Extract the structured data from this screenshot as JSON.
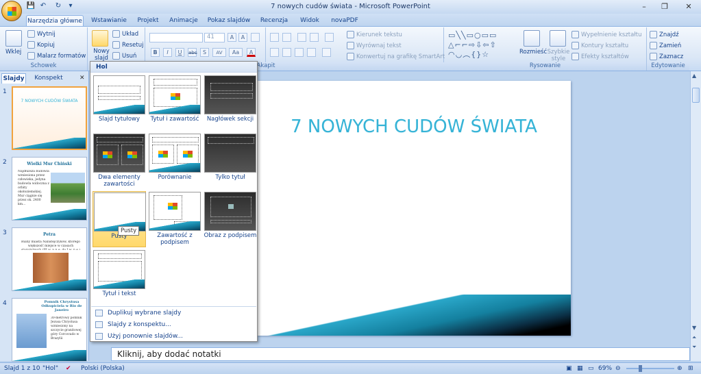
{
  "window": {
    "title": "7 nowych cudów świata - Microsoft PowerPoint",
    "minimize": "–",
    "restore": "❐",
    "close": "✕"
  },
  "qat": {
    "save": "💾",
    "undo": "↶",
    "redo": "↻",
    "more": "▾"
  },
  "tabs": [
    "Narzędzia główne",
    "Wstawianie",
    "Projekt",
    "Animacje",
    "Pokaz slajdów",
    "Recenzja",
    "Widok",
    "novaPDF"
  ],
  "ribbon": {
    "clipboard": {
      "label": "Schowek",
      "paste": "Wklej",
      "cut": "Wytnij",
      "copy": "Kopiuj",
      "format_painter": "Malarz formatów"
    },
    "slides": {
      "new_slide": "Nowy slajd",
      "layout": "Układ",
      "reset": "Resetuj",
      "delete": "Usuń"
    },
    "font": {
      "size": "41",
      "bold": "B",
      "italic": "I",
      "underline": "U",
      "strike": "abc",
      "shadow": "S",
      "spacing": "AV",
      "case": "Aa",
      "color": "A",
      "grow": "A",
      "shrink": "A"
    },
    "paragraph": {
      "label": "Akapit",
      "text_direction": "Kierunek tekstu",
      "align_text": "Wyrównaj tekst",
      "smartart": "Konwertuj na grafikę SmartArt"
    },
    "drawing": {
      "label": "Rysowanie",
      "arrange": "Rozmieść",
      "quick_styles": "Szybkie style",
      "fill": "Wypełnienie kształtu",
      "outline": "Kontury kształtu",
      "effects": "Efekty kształtów"
    },
    "editing": {
      "label": "Edytowanie",
      "find": "Znajdź",
      "replace": "Zamień",
      "select": "Zaznacz"
    }
  },
  "left_pane": {
    "tabs": [
      "Slajdy",
      "Konspekt"
    ],
    "slides": [
      {
        "num": "1",
        "title": "7 NOWYCH CUDÓW ŚWIATA"
      },
      {
        "num": "2",
        "title": "Wielki Mur Chiński",
        "text": "Najdłuższa budowla wzniesiona przez człowieka, jedyna budowla widoczna z orbity okołoziemskiej. Mur ciągnie się przez ok. 2400 km..."
      },
      {
        "num": "3",
        "title": "Petra",
        "text": "Ruiny miasta Nabatejczyków, którego większość miejsce w czasach starożytnych (III w. p.n.e. do I w. n.e.)"
      },
      {
        "num": "4",
        "title": "Pomnik Chrystusa Odkupiciela w Rio de Janeiro",
        "text": "30-metrowy pomnik Jezusa Chrystusa wzniesiony na szczycie granitowej góry Corcovado w Brazylii"
      }
    ]
  },
  "main": {
    "slide_title": "7 NOWYCH CUDÓW ŚWIATA",
    "notes_placeholder": "Kliknij, aby dodać notatki"
  },
  "dropdown": {
    "header": "Hol",
    "layouts": [
      "Slajd tytułowy",
      "Tytuł i zawartość",
      "Nagłówek sekcji",
      "Dwa elementy zawartości",
      "Porównanie",
      "Tylko tytuł",
      "Pusty",
      "Zawartość z podpisem",
      "Obraz z podpisem",
      "Tytuł i tekst"
    ],
    "tooltip": "Pusty",
    "menu": [
      "Duplikuj wybrane slajdy",
      "Slajdy z konspektu...",
      "Użyj ponownie slajdów..."
    ]
  },
  "status": {
    "slide_info": "Slajd 1 z 10",
    "theme": "\"Hol\"",
    "language": "Polski (Polska)",
    "zoom": "69%"
  }
}
